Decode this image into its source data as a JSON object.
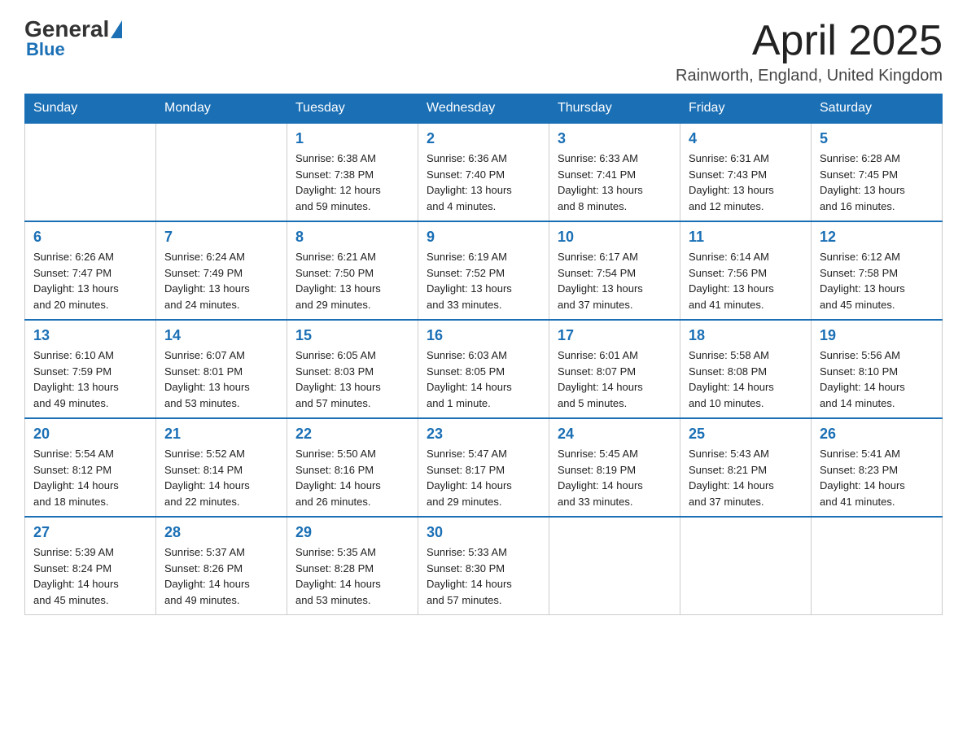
{
  "header": {
    "logo_general": "General",
    "logo_blue": "Blue",
    "month_title": "April 2025",
    "location": "Rainworth, England, United Kingdom"
  },
  "columns": [
    "Sunday",
    "Monday",
    "Tuesday",
    "Wednesday",
    "Thursday",
    "Friday",
    "Saturday"
  ],
  "weeks": [
    [
      {
        "day": "",
        "info": ""
      },
      {
        "day": "",
        "info": ""
      },
      {
        "day": "1",
        "info": "Sunrise: 6:38 AM\nSunset: 7:38 PM\nDaylight: 12 hours\nand 59 minutes."
      },
      {
        "day": "2",
        "info": "Sunrise: 6:36 AM\nSunset: 7:40 PM\nDaylight: 13 hours\nand 4 minutes."
      },
      {
        "day": "3",
        "info": "Sunrise: 6:33 AM\nSunset: 7:41 PM\nDaylight: 13 hours\nand 8 minutes."
      },
      {
        "day": "4",
        "info": "Sunrise: 6:31 AM\nSunset: 7:43 PM\nDaylight: 13 hours\nand 12 minutes."
      },
      {
        "day": "5",
        "info": "Sunrise: 6:28 AM\nSunset: 7:45 PM\nDaylight: 13 hours\nand 16 minutes."
      }
    ],
    [
      {
        "day": "6",
        "info": "Sunrise: 6:26 AM\nSunset: 7:47 PM\nDaylight: 13 hours\nand 20 minutes."
      },
      {
        "day": "7",
        "info": "Sunrise: 6:24 AM\nSunset: 7:49 PM\nDaylight: 13 hours\nand 24 minutes."
      },
      {
        "day": "8",
        "info": "Sunrise: 6:21 AM\nSunset: 7:50 PM\nDaylight: 13 hours\nand 29 minutes."
      },
      {
        "day": "9",
        "info": "Sunrise: 6:19 AM\nSunset: 7:52 PM\nDaylight: 13 hours\nand 33 minutes."
      },
      {
        "day": "10",
        "info": "Sunrise: 6:17 AM\nSunset: 7:54 PM\nDaylight: 13 hours\nand 37 minutes."
      },
      {
        "day": "11",
        "info": "Sunrise: 6:14 AM\nSunset: 7:56 PM\nDaylight: 13 hours\nand 41 minutes."
      },
      {
        "day": "12",
        "info": "Sunrise: 6:12 AM\nSunset: 7:58 PM\nDaylight: 13 hours\nand 45 minutes."
      }
    ],
    [
      {
        "day": "13",
        "info": "Sunrise: 6:10 AM\nSunset: 7:59 PM\nDaylight: 13 hours\nand 49 minutes."
      },
      {
        "day": "14",
        "info": "Sunrise: 6:07 AM\nSunset: 8:01 PM\nDaylight: 13 hours\nand 53 minutes."
      },
      {
        "day": "15",
        "info": "Sunrise: 6:05 AM\nSunset: 8:03 PM\nDaylight: 13 hours\nand 57 minutes."
      },
      {
        "day": "16",
        "info": "Sunrise: 6:03 AM\nSunset: 8:05 PM\nDaylight: 14 hours\nand 1 minute."
      },
      {
        "day": "17",
        "info": "Sunrise: 6:01 AM\nSunset: 8:07 PM\nDaylight: 14 hours\nand 5 minutes."
      },
      {
        "day": "18",
        "info": "Sunrise: 5:58 AM\nSunset: 8:08 PM\nDaylight: 14 hours\nand 10 minutes."
      },
      {
        "day": "19",
        "info": "Sunrise: 5:56 AM\nSunset: 8:10 PM\nDaylight: 14 hours\nand 14 minutes."
      }
    ],
    [
      {
        "day": "20",
        "info": "Sunrise: 5:54 AM\nSunset: 8:12 PM\nDaylight: 14 hours\nand 18 minutes."
      },
      {
        "day": "21",
        "info": "Sunrise: 5:52 AM\nSunset: 8:14 PM\nDaylight: 14 hours\nand 22 minutes."
      },
      {
        "day": "22",
        "info": "Sunrise: 5:50 AM\nSunset: 8:16 PM\nDaylight: 14 hours\nand 26 minutes."
      },
      {
        "day": "23",
        "info": "Sunrise: 5:47 AM\nSunset: 8:17 PM\nDaylight: 14 hours\nand 29 minutes."
      },
      {
        "day": "24",
        "info": "Sunrise: 5:45 AM\nSunset: 8:19 PM\nDaylight: 14 hours\nand 33 minutes."
      },
      {
        "day": "25",
        "info": "Sunrise: 5:43 AM\nSunset: 8:21 PM\nDaylight: 14 hours\nand 37 minutes."
      },
      {
        "day": "26",
        "info": "Sunrise: 5:41 AM\nSunset: 8:23 PM\nDaylight: 14 hours\nand 41 minutes."
      }
    ],
    [
      {
        "day": "27",
        "info": "Sunrise: 5:39 AM\nSunset: 8:24 PM\nDaylight: 14 hours\nand 45 minutes."
      },
      {
        "day": "28",
        "info": "Sunrise: 5:37 AM\nSunset: 8:26 PM\nDaylight: 14 hours\nand 49 minutes."
      },
      {
        "day": "29",
        "info": "Sunrise: 5:35 AM\nSunset: 8:28 PM\nDaylight: 14 hours\nand 53 minutes."
      },
      {
        "day": "30",
        "info": "Sunrise: 5:33 AM\nSunset: 8:30 PM\nDaylight: 14 hours\nand 57 minutes."
      },
      {
        "day": "",
        "info": ""
      },
      {
        "day": "",
        "info": ""
      },
      {
        "day": "",
        "info": ""
      }
    ]
  ]
}
